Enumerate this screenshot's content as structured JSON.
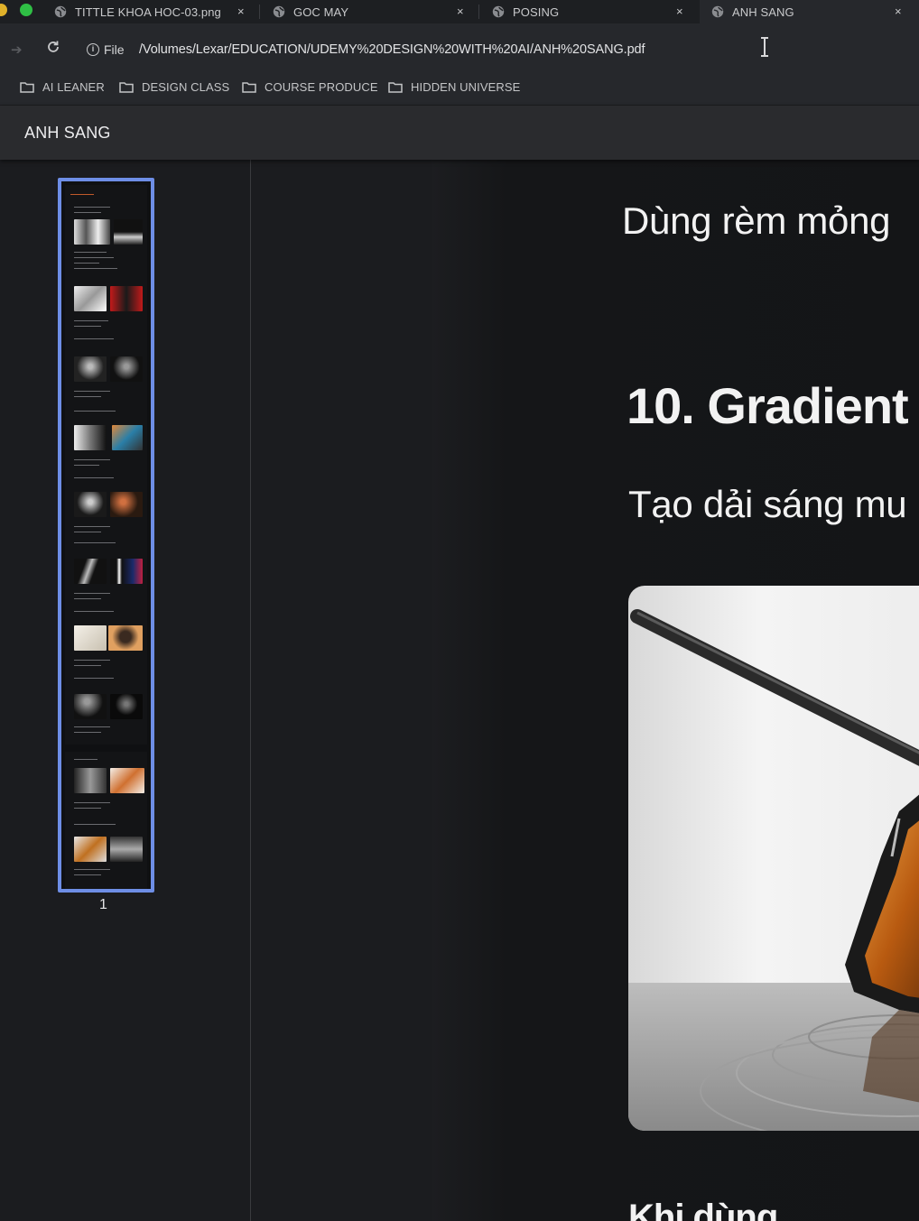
{
  "tabs": [
    {
      "title": "TITTLE KHOA HOC-03.png",
      "close": "×",
      "active": false
    },
    {
      "title": "GOC MAY",
      "close": "×",
      "active": false
    },
    {
      "title": "POSING",
      "close": "×",
      "active": false
    },
    {
      "title": "ANH SANG",
      "close": "×",
      "active": true
    }
  ],
  "address": {
    "scheme_label": "File",
    "url": "/Volumes/Lexar/EDUCATION/UDEMY%20DESIGN%20WITH%20AI/ANH%20SANG.pdf"
  },
  "bookmarks": [
    "AI LEANER",
    "DESIGN CLASS",
    "COURSE PRODUCE",
    "HIDDEN UNIVERSE"
  ],
  "viewer": {
    "title": "ANH SANG",
    "thumbnail_page_number": "1"
  },
  "document": {
    "line_1": "Dùng rèm mỏng",
    "heading": "10. Gradient",
    "line_2": "Tạo dải sáng mu",
    "heading_bottom": "Khi dùng"
  },
  "colors": {
    "accent_thumbnail_border": "#6e8ee6",
    "traffic_yellow": "#e0b12a",
    "traffic_green": "#2fbf45"
  },
  "icons": {
    "tab_favicon": "globe-icon",
    "reload": "reload-icon",
    "site_info": "info-icon",
    "bookmark": "folder-icon",
    "cursor": "text-cursor-icon"
  }
}
